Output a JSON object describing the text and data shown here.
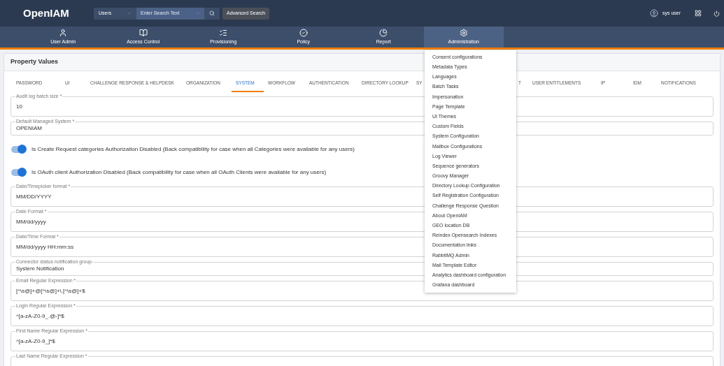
{
  "header": {
    "logo": "OpenIAM",
    "search": {
      "scope": "Users",
      "placeholder": "Enter Search Text",
      "advanced": "Advanced Search"
    },
    "user": "sys user"
  },
  "nav": [
    {
      "kind": "user",
      "label": "User Admin",
      "selected": false
    },
    {
      "kind": "book",
      "label": "Access Control",
      "selected": false
    },
    {
      "kind": "list",
      "label": "Provisioning",
      "selected": false
    },
    {
      "kind": "check",
      "label": "Policy",
      "selected": false
    },
    {
      "kind": "pie",
      "label": "Report",
      "selected": false
    },
    {
      "kind": "gear",
      "label": "Administration",
      "selected": true
    }
  ],
  "menu": [
    "Consent configurations",
    "Metadata Types",
    "Languages",
    "Batch Tasks",
    "Impersonation",
    "Page Template",
    "UI Themes",
    "Custom Fields",
    "System Configuration",
    "Mailbox Configurations",
    "Log Viewer",
    "Sequence generators",
    "Groovy Manager",
    "Directory Lookup Configuration",
    "Self Registration Configuration",
    "Challenge Response Question",
    "About OpenIAM",
    "GEO location DB",
    "Reindex Opensearch Indexes",
    "Documentation links",
    "RabbitMQ Admin",
    "Mail Template Editor",
    "Analytics dashboard configuration",
    "Grafana dashboard"
  ],
  "panel": {
    "title": "Property Values",
    "tabs": [
      {
        "label": "PASSWORD",
        "selected": false
      },
      {
        "label": "UI",
        "selected": false
      },
      {
        "label": "CHALLENGE RESPONSE & HELPDESK",
        "selected": false
      },
      {
        "label": "ORGANIZATION",
        "selected": false
      },
      {
        "label": "SYSTEM",
        "selected": true
      },
      {
        "label": "WORKFLOW",
        "selected": false
      },
      {
        "label": "AUTHENTICATION",
        "selected": false
      },
      {
        "label": "DIRECTORY LOOKUP",
        "selected": false
      },
      {
        "label": "SY",
        "selected": false
      },
      {
        "label": "T",
        "selected": false
      },
      {
        "label": "USER ENTITLEMENTS",
        "selected": false
      },
      {
        "label": "IP",
        "selected": false
      },
      {
        "label": "IDM",
        "selected": false
      },
      {
        "label": "NOTIFICATIONS",
        "selected": false
      }
    ],
    "fields": [
      {
        "kind": "text",
        "label": "Audit log batch size *",
        "value": "10"
      },
      {
        "kind": "select",
        "label": "Default Managed System *",
        "value": "OPENIAM"
      },
      {
        "kind": "toggle",
        "label": "Is Create Request categories Authorization Disabled (Back compatibility for case when all Categories were available for any users)",
        "on": true
      },
      {
        "kind": "toggle",
        "label": "Is OAuth client Authorization Disabled (Back compatibility for case when all OAuth Clients were available for any users)",
        "on": true
      },
      {
        "kind": "text",
        "label": "Date/Timepicker format *",
        "value": "MM/DD/YYYY"
      },
      {
        "kind": "text",
        "label": "Date Format *",
        "value": "MM/dd/yyyy"
      },
      {
        "kind": "text",
        "label": "Date/Time Format *",
        "value": "MM/dd/yyyy HH:mm:ss"
      },
      {
        "kind": "select",
        "label": "Connector status notification group",
        "value": "System Notification"
      },
      {
        "kind": "text",
        "label": "Email Regular Expression *",
        "value": "[^\\s@]+@[^\\s@]+\\.[^\\s@]+$"
      },
      {
        "kind": "text",
        "label": "Login Regular Expression *",
        "value": "^[a-zA-Z0-9_.@-]*$"
      },
      {
        "kind": "text",
        "label": "First Name Regular Expression *",
        "value": "^[a-zA-Z0-9_]*$"
      },
      {
        "kind": "text",
        "label": "Last Name Regular Expression *"
      }
    ]
  }
}
